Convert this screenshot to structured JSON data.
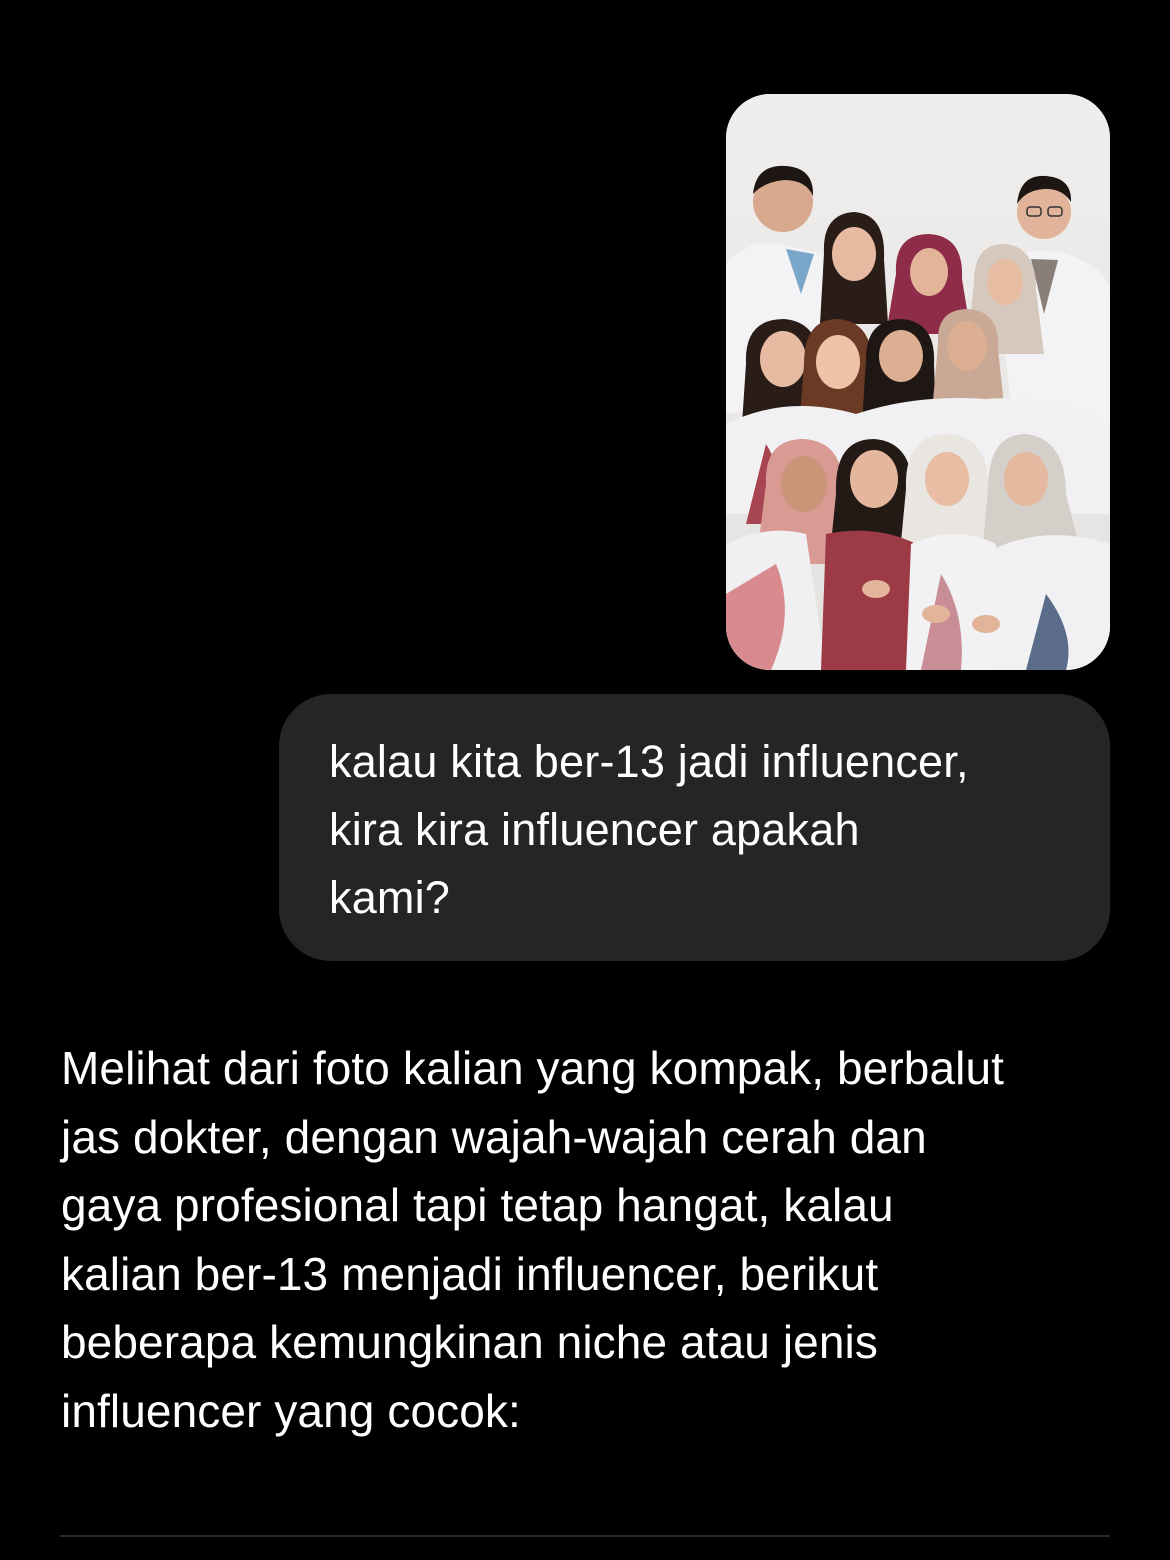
{
  "conversation": {
    "attachment": {
      "kind": "photo",
      "icon": "group-photo",
      "colors": {
        "background": "#ecebea",
        "coat": "#f4f4f6",
        "scrubs_maroon": "#9c3a45",
        "scrubs_pink": "#d88a8e",
        "hijab_maroon": "#8e2c4a",
        "hijab_beige": "#d6c8bc",
        "hijab_pink": "#d89a92",
        "hair": "#2a1d18",
        "skin": "#e0b39a"
      }
    },
    "user_message": {
      "text": "kalau kita ber-13 jadi influencer,\nkira kira influencer apakah\nkami?"
    },
    "assistant_message": {
      "text": "Melihat dari foto kalian yang kompak, berbalut\njas dokter, dengan wajah-wajah cerah dan\ngaya profesional tapi tetap hangat, kalau\nkalian ber-13 menjadi influencer, berikut\nbeberapa kemungkinan niche atau jenis\ninfluencer yang cocok:"
    }
  },
  "theme": {
    "background": "#000000",
    "user_bubble": "#252525",
    "text": "#ffffff",
    "divider": "#2a2a2a"
  }
}
